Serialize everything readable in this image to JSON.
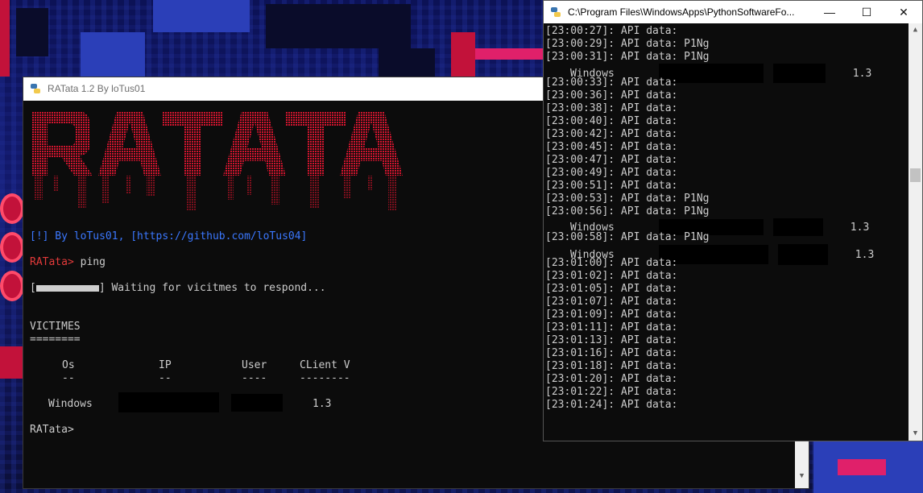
{
  "left_window": {
    "title": "RATata 1.2 By loTus01",
    "banner_text": "RATATA",
    "info_line": "[!] By loTus01, [https://github.com/loTus04]",
    "prompt1": "RATata> ",
    "command1": "ping",
    "progress_open": "[",
    "progress_close": "] Waiting for vicitmes to respond...",
    "victims_heading": "VICTIMES",
    "victims_rule": "========",
    "columns": [
      "Os",
      "IP",
      "User",
      "CLient V"
    ],
    "column_rules": [
      "--",
      "--",
      "----",
      "--------"
    ],
    "row": {
      "os": "Windows",
      "version": "1.3"
    },
    "prompt2": "RATata>"
  },
  "right_window": {
    "title": "C:\\Program Files\\WindowsApps\\PythonSoftwareFo...",
    "lines": [
      {
        "type": "log",
        "text": "[23:00:27]: API data:"
      },
      {
        "type": "log",
        "text": "[23:00:29]: API data: P1Ng"
      },
      {
        "type": "log",
        "text": "[23:00:31]: API data: P1Ng"
      },
      {
        "type": "victim",
        "os": "Windows",
        "version": "1.3"
      },
      {
        "type": "log",
        "text": "[23:00:33]: API data:"
      },
      {
        "type": "log",
        "text": "[23:00:36]: API data:"
      },
      {
        "type": "log",
        "text": "[23:00:38]: API data:"
      },
      {
        "type": "log",
        "text": "[23:00:40]: API data:"
      },
      {
        "type": "log",
        "text": "[23:00:42]: API data:"
      },
      {
        "type": "log",
        "text": "[23:00:45]: API data:"
      },
      {
        "type": "log",
        "text": "[23:00:47]: API data:"
      },
      {
        "type": "log",
        "text": "[23:00:49]: API data:"
      },
      {
        "type": "log",
        "text": "[23:00:51]: API data:"
      },
      {
        "type": "log",
        "text": "[23:00:53]: API data: P1Ng"
      },
      {
        "type": "log",
        "text": "[23:00:56]: API data: P1Ng"
      },
      {
        "type": "victim",
        "os": "Windows",
        "version": "1.3"
      },
      {
        "type": "log",
        "text": "[23:00:58]: API data: P1Ng"
      },
      {
        "type": "victim",
        "os": "Windows",
        "version": "1.3"
      },
      {
        "type": "log",
        "text": "[23:01:00]: API data:"
      },
      {
        "type": "log",
        "text": "[23:01:02]: API data:"
      },
      {
        "type": "log",
        "text": "[23:01:05]: API data:"
      },
      {
        "type": "log",
        "text": "[23:01:07]: API data:"
      },
      {
        "type": "log",
        "text": "[23:01:09]: API data:"
      },
      {
        "type": "log",
        "text": "[23:01:11]: API data:"
      },
      {
        "type": "log",
        "text": "[23:01:13]: API data:"
      },
      {
        "type": "log",
        "text": "[23:01:16]: API data:"
      },
      {
        "type": "log",
        "text": "[23:01:18]: API data:"
      },
      {
        "type": "log",
        "text": "[23:01:20]: API data:"
      },
      {
        "type": "log",
        "text": "[23:01:22]: API data:"
      },
      {
        "type": "log",
        "text": "[23:01:24]: API data:"
      }
    ]
  },
  "window_controls": {
    "minimize": "—",
    "maximize": "☐",
    "close": "✕"
  },
  "colors": {
    "banner_red": "#d3142e",
    "prompt_red": "#e23a3a",
    "link_blue": "#3b78ff",
    "console_bg": "#0c0c0c"
  },
  "icons": [
    "python-icon",
    "minimize-icon",
    "maximize-icon",
    "close-icon",
    "scroll-up-icon",
    "scroll-down-icon"
  ]
}
